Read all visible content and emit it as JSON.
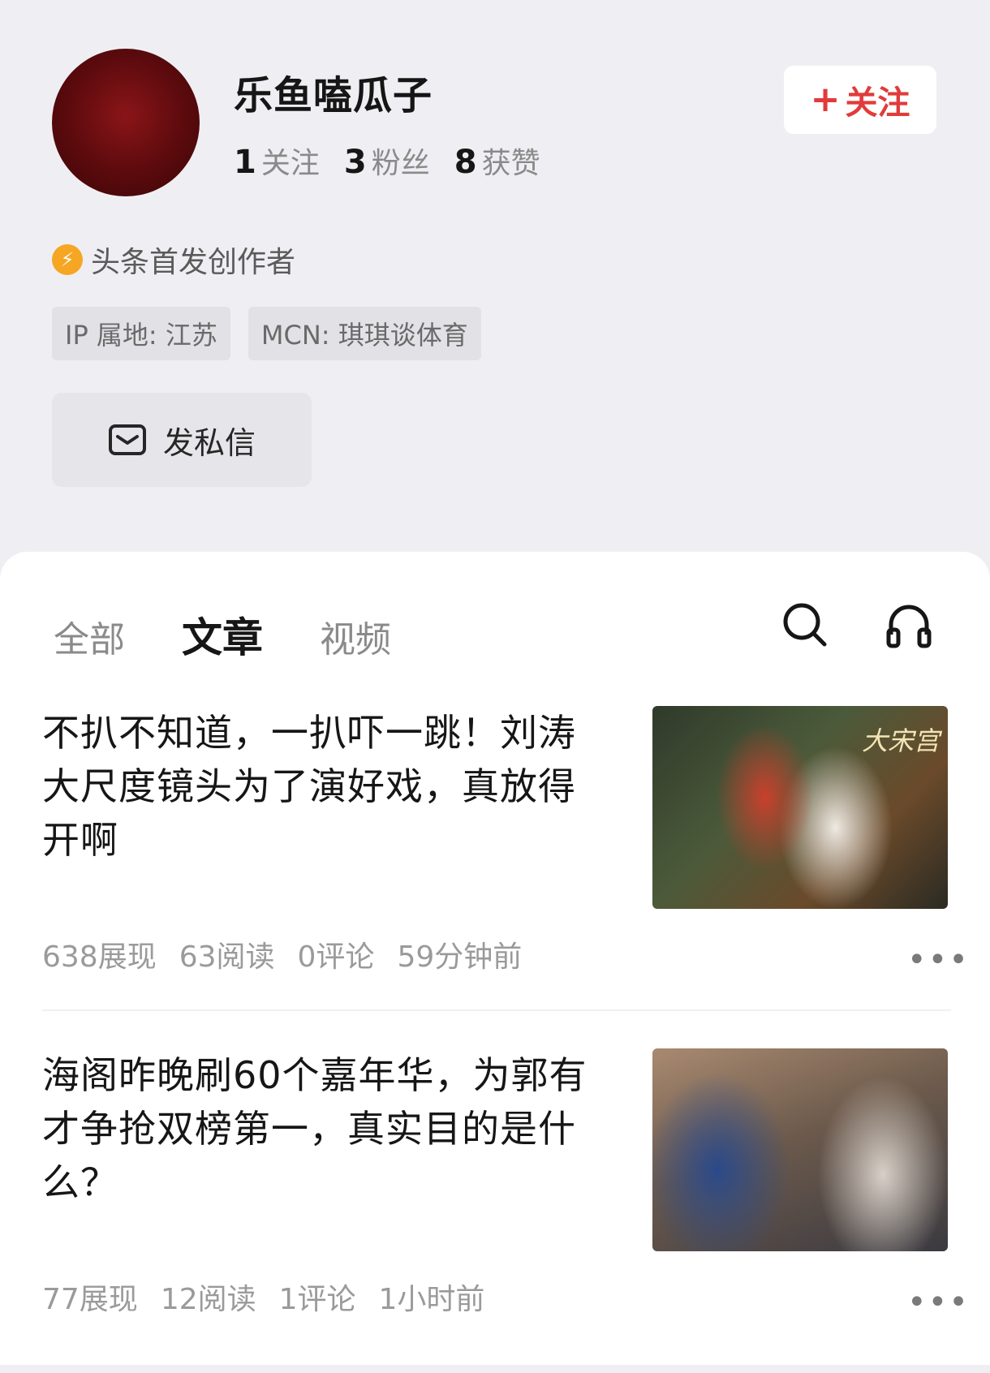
{
  "profile": {
    "name": "乐鱼嗑瓜子",
    "stats": [
      {
        "num": "1",
        "label": "关注"
      },
      {
        "num": "3",
        "label": "粉丝"
      },
      {
        "num": "8",
        "label": "获赞"
      }
    ],
    "follow_label": "关注",
    "badge": "头条首发创作者",
    "tags": [
      "IP 属地: 江苏",
      "MCN: 琪琪谈体育"
    ],
    "message_label": "发私信"
  },
  "tabs": [
    "全部",
    "文章",
    "视频"
  ],
  "active_tab": "文章",
  "articles": [
    {
      "title": "不扒不知道，一扒吓一跳！刘涛大尺度镜头为了演好戏，真放得开啊",
      "thumb_caption": "大宋宫",
      "meta": [
        "638展现",
        "63阅读",
        "0评论",
        "59分钟前"
      ]
    },
    {
      "title": "海阁昨晚刷60个嘉年华，为郭有才争抢双榜第一，真实目的是什么？",
      "meta": [
        "77展现",
        "12阅读",
        "1评论",
        "1小时前"
      ]
    }
  ],
  "more_label": "•••"
}
